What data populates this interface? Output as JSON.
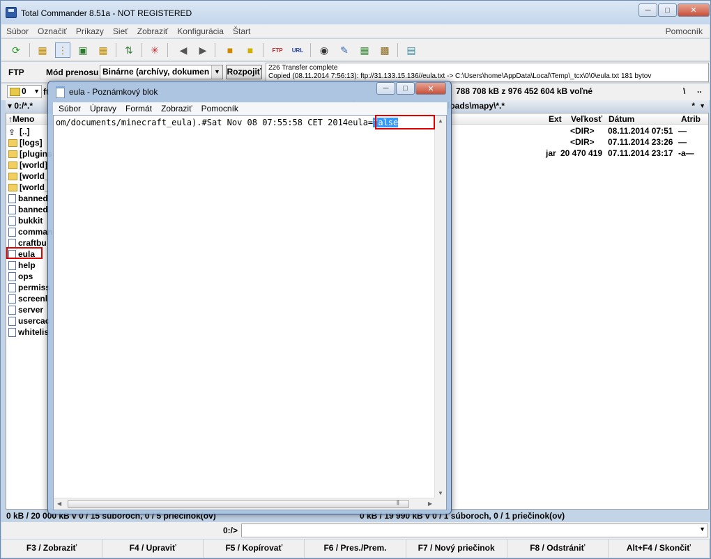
{
  "tc": {
    "title": "Total Commander 8.51a - NOT REGISTERED",
    "menu": [
      "Súbor",
      "Označiť",
      "Príkazy",
      "Sieť",
      "Zobraziť",
      "Konfigurácia",
      "Štart"
    ],
    "menu_help": "Pomocník",
    "ftp": {
      "label": "FTP",
      "mode_label": "Mód prenosu",
      "mode_value": "Binárne (archívy, dokumen",
      "disconnect": "Rozpojiť",
      "log_line1": "226 Transfer complete",
      "log_line2": "Copied (08.11.2014 7:56:13): ftp://31.133.15.136//eula.txt -> C:\\Users\\home\\AppData\\Local\\Temp\\_tcx\\0\\0\\eula.txt 181 bytov"
    },
    "drive": {
      "left_drive": "0",
      "left_stub": "ft",
      "free_space": "788 708 kB z 976 452 604 kB voľné",
      "backslash": "\\",
      "dotdot": ".."
    },
    "path": {
      "left": "▾ 0:/*.*",
      "right": "loads\\mapy\\*.*",
      "right_star": "*",
      "right_arrow": "▼"
    },
    "left_panel": {
      "col_name": "↑Meno",
      "rows": [
        {
          "name": "[..]",
          "icon": "up-arrow-icon"
        },
        {
          "name": "[logs]",
          "icon": "folder-icon"
        },
        {
          "name": "[plugins",
          "icon": "folder-icon"
        },
        {
          "name": "[world]",
          "icon": "folder-icon"
        },
        {
          "name": "[world_",
          "icon": "folder-icon"
        },
        {
          "name": "[world_",
          "icon": "folder-icon"
        },
        {
          "name": "banned",
          "icon": "file-icon"
        },
        {
          "name": "banned",
          "icon": "file-icon"
        },
        {
          "name": "bukkit",
          "icon": "file-icon"
        },
        {
          "name": "comman",
          "icon": "file-icon"
        },
        {
          "name": "craftbu",
          "icon": "file-icon"
        },
        {
          "name": "eula",
          "icon": "file-icon"
        },
        {
          "name": "help",
          "icon": "file-icon"
        },
        {
          "name": "ops",
          "icon": "file-icon"
        },
        {
          "name": "permiss",
          "icon": "file-icon"
        },
        {
          "name": "screenl",
          "icon": "file-icon"
        },
        {
          "name": "server",
          "icon": "file-icon"
        },
        {
          "name": "usercac",
          "icon": "file-icon"
        },
        {
          "name": "whitelis",
          "icon": "file-icon"
        }
      ]
    },
    "right_panel": {
      "col_ext": "Ext",
      "col_size": "Veľkosť",
      "col_date": "Dátum",
      "col_attr": "Atrib",
      "rows": [
        {
          "ext": "",
          "size": "<DIR>",
          "date": "08.11.2014 07:51",
          "attr": "—"
        },
        {
          "ext": "",
          "size": "<DIR>",
          "date": "07.11.2014 23:26",
          "attr": "—"
        },
        {
          "ext": "jar",
          "size": "20 470 419",
          "date": "07.11.2014 23:17",
          "attr": "-a—"
        }
      ]
    },
    "status_left": "0 kB / 20 000 kB v 0 / 15 súboroch, 0 / 5 priečinok(ov)",
    "status_right": "0 kB / 19 990 kB v 0 / 1 súboroch, 0 / 1 priečinok(ov)",
    "cmd_prefix": "0:/>",
    "fkeys": [
      "F3 / Zobraziť",
      "F4 / Upraviť",
      "F5 / Kopírovať",
      "F6 / Pres./Prem.",
      "F7 / Nový priečinok",
      "F8 / Odstrániť",
      "Alt+F4 / Skončiť"
    ]
  },
  "notepad": {
    "title": "eula - Poznámkový blok",
    "menu": [
      "Súbor",
      "Úpravy",
      "Formát",
      "Zobraziť",
      "Pomocník"
    ],
    "text_before": "om/documents/minecraft_eula).#Sat Nov 08 07:55:58 CET 2014",
    "text_key": "eula=",
    "text_selected": "false"
  },
  "colors": {
    "highlight": "#e00000",
    "selection": "#3399ff"
  }
}
